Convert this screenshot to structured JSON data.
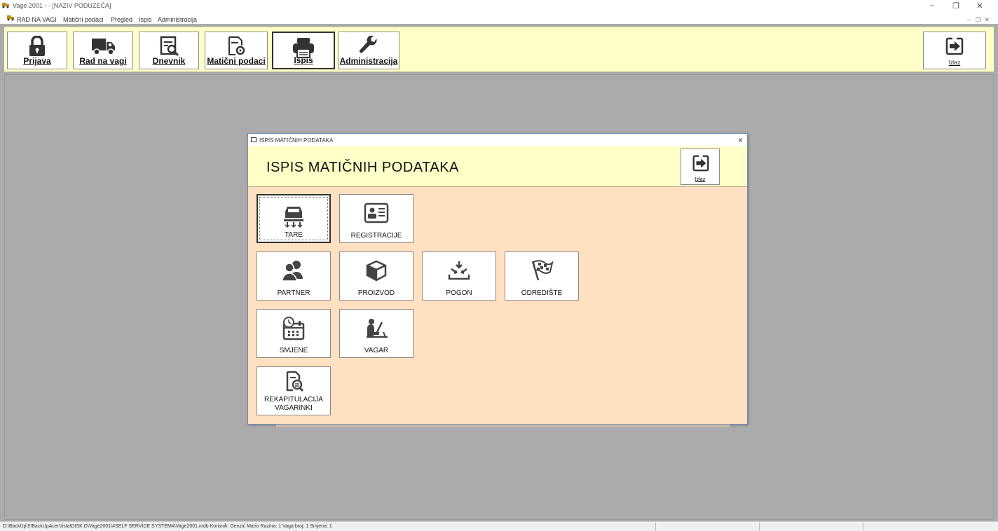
{
  "window": {
    "title": "Vage 2001 - - [NAZIV PODUZEĆA]"
  },
  "menu": {
    "items": [
      "RAD NA VAGI",
      "Matični podaci",
      "Pregled",
      "Ispis",
      "Administracija"
    ]
  },
  "toolbar": {
    "buttons": [
      "Prijava",
      "Rad na vagi",
      "Dnevnik",
      "Matični podaci",
      "Ispis",
      "Administracija"
    ],
    "exit_label": "Izlaz"
  },
  "dialog": {
    "window_title": "ISPIS MATIČNIH PODATAKA",
    "header_title": "ISPIS MATIČNIH PODATAKA",
    "exit_label": "Izlaz",
    "buttons": {
      "tare": "TARE",
      "registracije": "REGISTRACIJE",
      "partner": "PARTNER",
      "proizvod": "PROIZVOD",
      "pogon": "POGON",
      "odrediste": "ODREDIŠTE",
      "smjene": "SMJENE",
      "vagar": "VAGAR",
      "rekap_line1": "REKAPITULACIJA",
      "rekap_line2": "VAGARINKI"
    }
  },
  "status": {
    "text": "D:\\BackUp\\!!!BackUpAcerVista\\DISK D\\Vage2001\\#SELF SERVICE SYSTEM#\\Vage2001.mdb  Korisnik: Genzić Mario   Razina: 1   Vaga broj: 1    Smjena: 1"
  }
}
